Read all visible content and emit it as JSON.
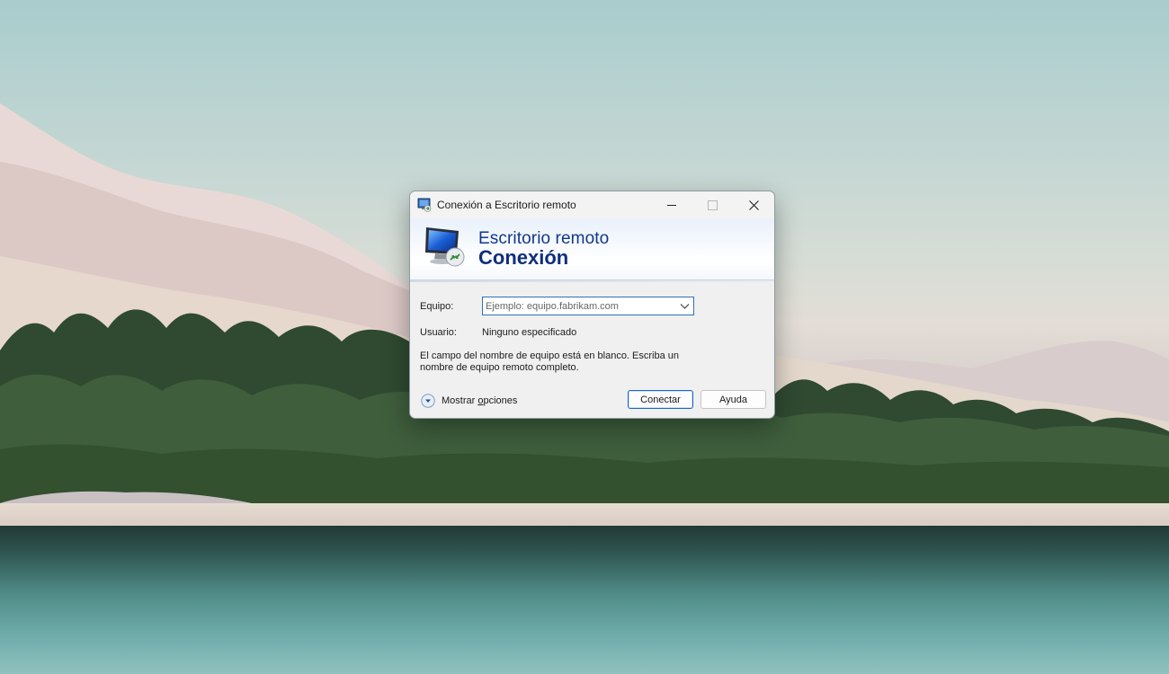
{
  "window": {
    "title": "Conexión a Escritorio remoto"
  },
  "banner": {
    "line1": "Escritorio remoto",
    "line2": "Conexión"
  },
  "form": {
    "computer_label": "Equipo:",
    "computer_value": "",
    "computer_placeholder": "Ejemplo: equipo.fabrikam.com",
    "user_label": "Usuario:",
    "user_value": "Ninguno especificado",
    "message": "El campo del nombre de equipo está en blanco. Escriba un nombre de equipo remoto completo."
  },
  "footer": {
    "options_label_pre": "Mostrar ",
    "options_label_accel": "o",
    "options_label_post": "pciones",
    "connect_label": "Conectar",
    "help_label": "Ayuda"
  },
  "icons": {
    "title": "remote-desktop-icon",
    "banner": "monitor-connection-icon",
    "minimize": "minimize-icon",
    "maximize": "maximize-icon",
    "close": "close-icon",
    "dropdown": "chevron-down-icon",
    "options": "expand-circle-icon"
  },
  "colors": {
    "banner_text": "#12378a",
    "focus_border": "#2f6fc0",
    "default_button_border": "#1f66c1"
  }
}
